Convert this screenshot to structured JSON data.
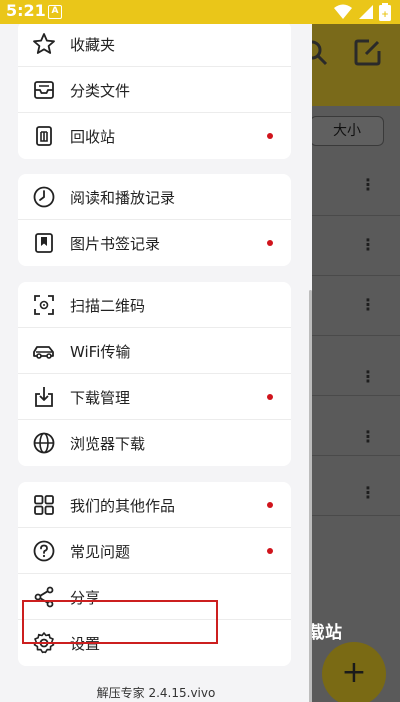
{
  "status_bar": {
    "time": "5:21",
    "notification_glyph": "A"
  },
  "background": {
    "sort_label": "大小",
    "watermark": "下载站",
    "fab_glyph": "+"
  },
  "drawer": {
    "groups": [
      {
        "items": [
          {
            "label": "收藏夹",
            "icon": "star-icon",
            "dot": false
          },
          {
            "label": "分类文件",
            "icon": "inbox-icon",
            "dot": false
          },
          {
            "label": "回收站",
            "icon": "trash-icon",
            "dot": true
          }
        ]
      },
      {
        "items": [
          {
            "label": "阅读和播放记录",
            "icon": "clock-icon",
            "dot": false
          },
          {
            "label": "图片书签记录",
            "icon": "bookmark-icon",
            "dot": true
          }
        ]
      },
      {
        "items": [
          {
            "label": "扫描二维码",
            "icon": "scan-icon",
            "dot": false
          },
          {
            "label": "WiFi传输",
            "icon": "car-icon",
            "dot": false
          },
          {
            "label": "下载管理",
            "icon": "download-icon",
            "dot": true
          },
          {
            "label": "浏览器下载",
            "icon": "globe-icon",
            "dot": false
          }
        ]
      },
      {
        "items": [
          {
            "label": "我们的其他作品",
            "icon": "grid-icon",
            "dot": true
          },
          {
            "label": "常见问题",
            "icon": "question-icon",
            "dot": true
          },
          {
            "label": "分享",
            "icon": "share-icon",
            "dot": false
          },
          {
            "label": "设置",
            "icon": "gear-icon",
            "dot": false
          }
        ]
      }
    ],
    "version": "解压专家 2.4.15.vivo"
  },
  "colors": {
    "status_bar": "#eac619",
    "badge": "#d0141c",
    "highlight": "#cc1f1f"
  }
}
